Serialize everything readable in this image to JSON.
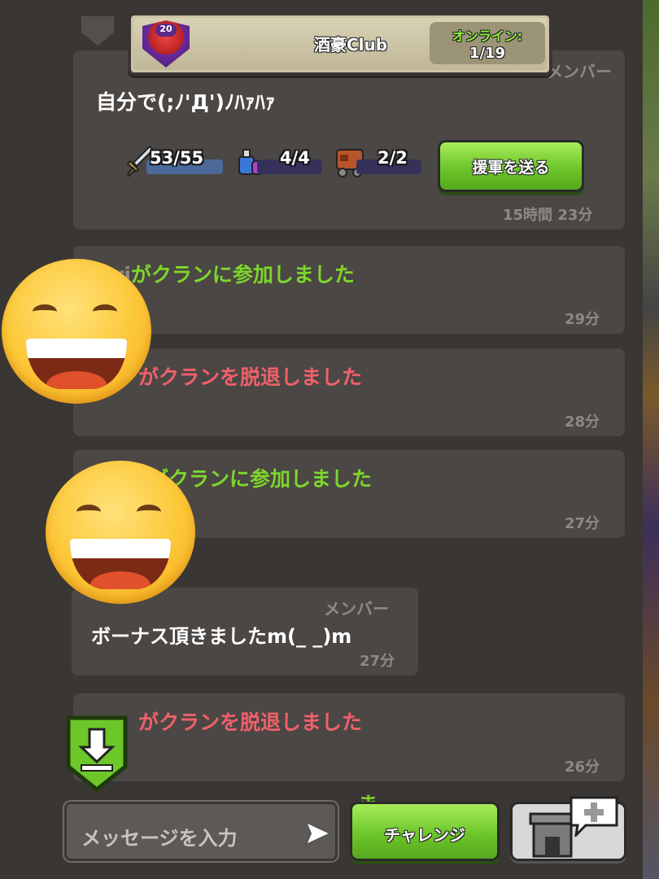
{
  "clan": {
    "badge_level": "20",
    "name": "酒豪Club",
    "online_label": "オンライン:",
    "online_count": "1/19"
  },
  "request_card": {
    "role": "メンバー",
    "message": "自分で(;ﾉ'Д')ﾉﾊｧﾊｧ",
    "troops": "53/55",
    "spells": "4/4",
    "siege": "2/2",
    "send_button": "援軍を送る",
    "time": "15時間 23分"
  },
  "events": [
    {
      "name": "ri",
      "text": "がクランに参加しました",
      "type": "join",
      "time": "29分"
    },
    {
      "name": "",
      "text": "がクランを脱退しました",
      "type": "leave",
      "time": "28分"
    },
    {
      "name": "",
      "text": "がクランに参加しました",
      "type": "join",
      "time": "27分"
    },
    {
      "name": "",
      "text": "がクランを脱退しました",
      "type": "leave",
      "time": "26分"
    }
  ],
  "chat_message": {
    "role": "メンバー",
    "text": "ボーナス頂きましたm(_ _)m",
    "time": "27分"
  },
  "footer": {
    "input_placeholder": "メッセージを入力",
    "challenge_button": "チャレンジ",
    "partial_text": "ま"
  },
  "colors": {
    "background": "#3a3633",
    "card": "#4b4744",
    "join_green": "#7dd62c",
    "leave_red": "#f0606c",
    "button_green": "#6dc62a"
  },
  "icons": [
    "sword-icon",
    "potion-icon",
    "siege-machine-icon",
    "send-arrow-icon",
    "download-icon",
    "clan-castle-icon",
    "plus-icon",
    "grinning-emoji-icon"
  ]
}
